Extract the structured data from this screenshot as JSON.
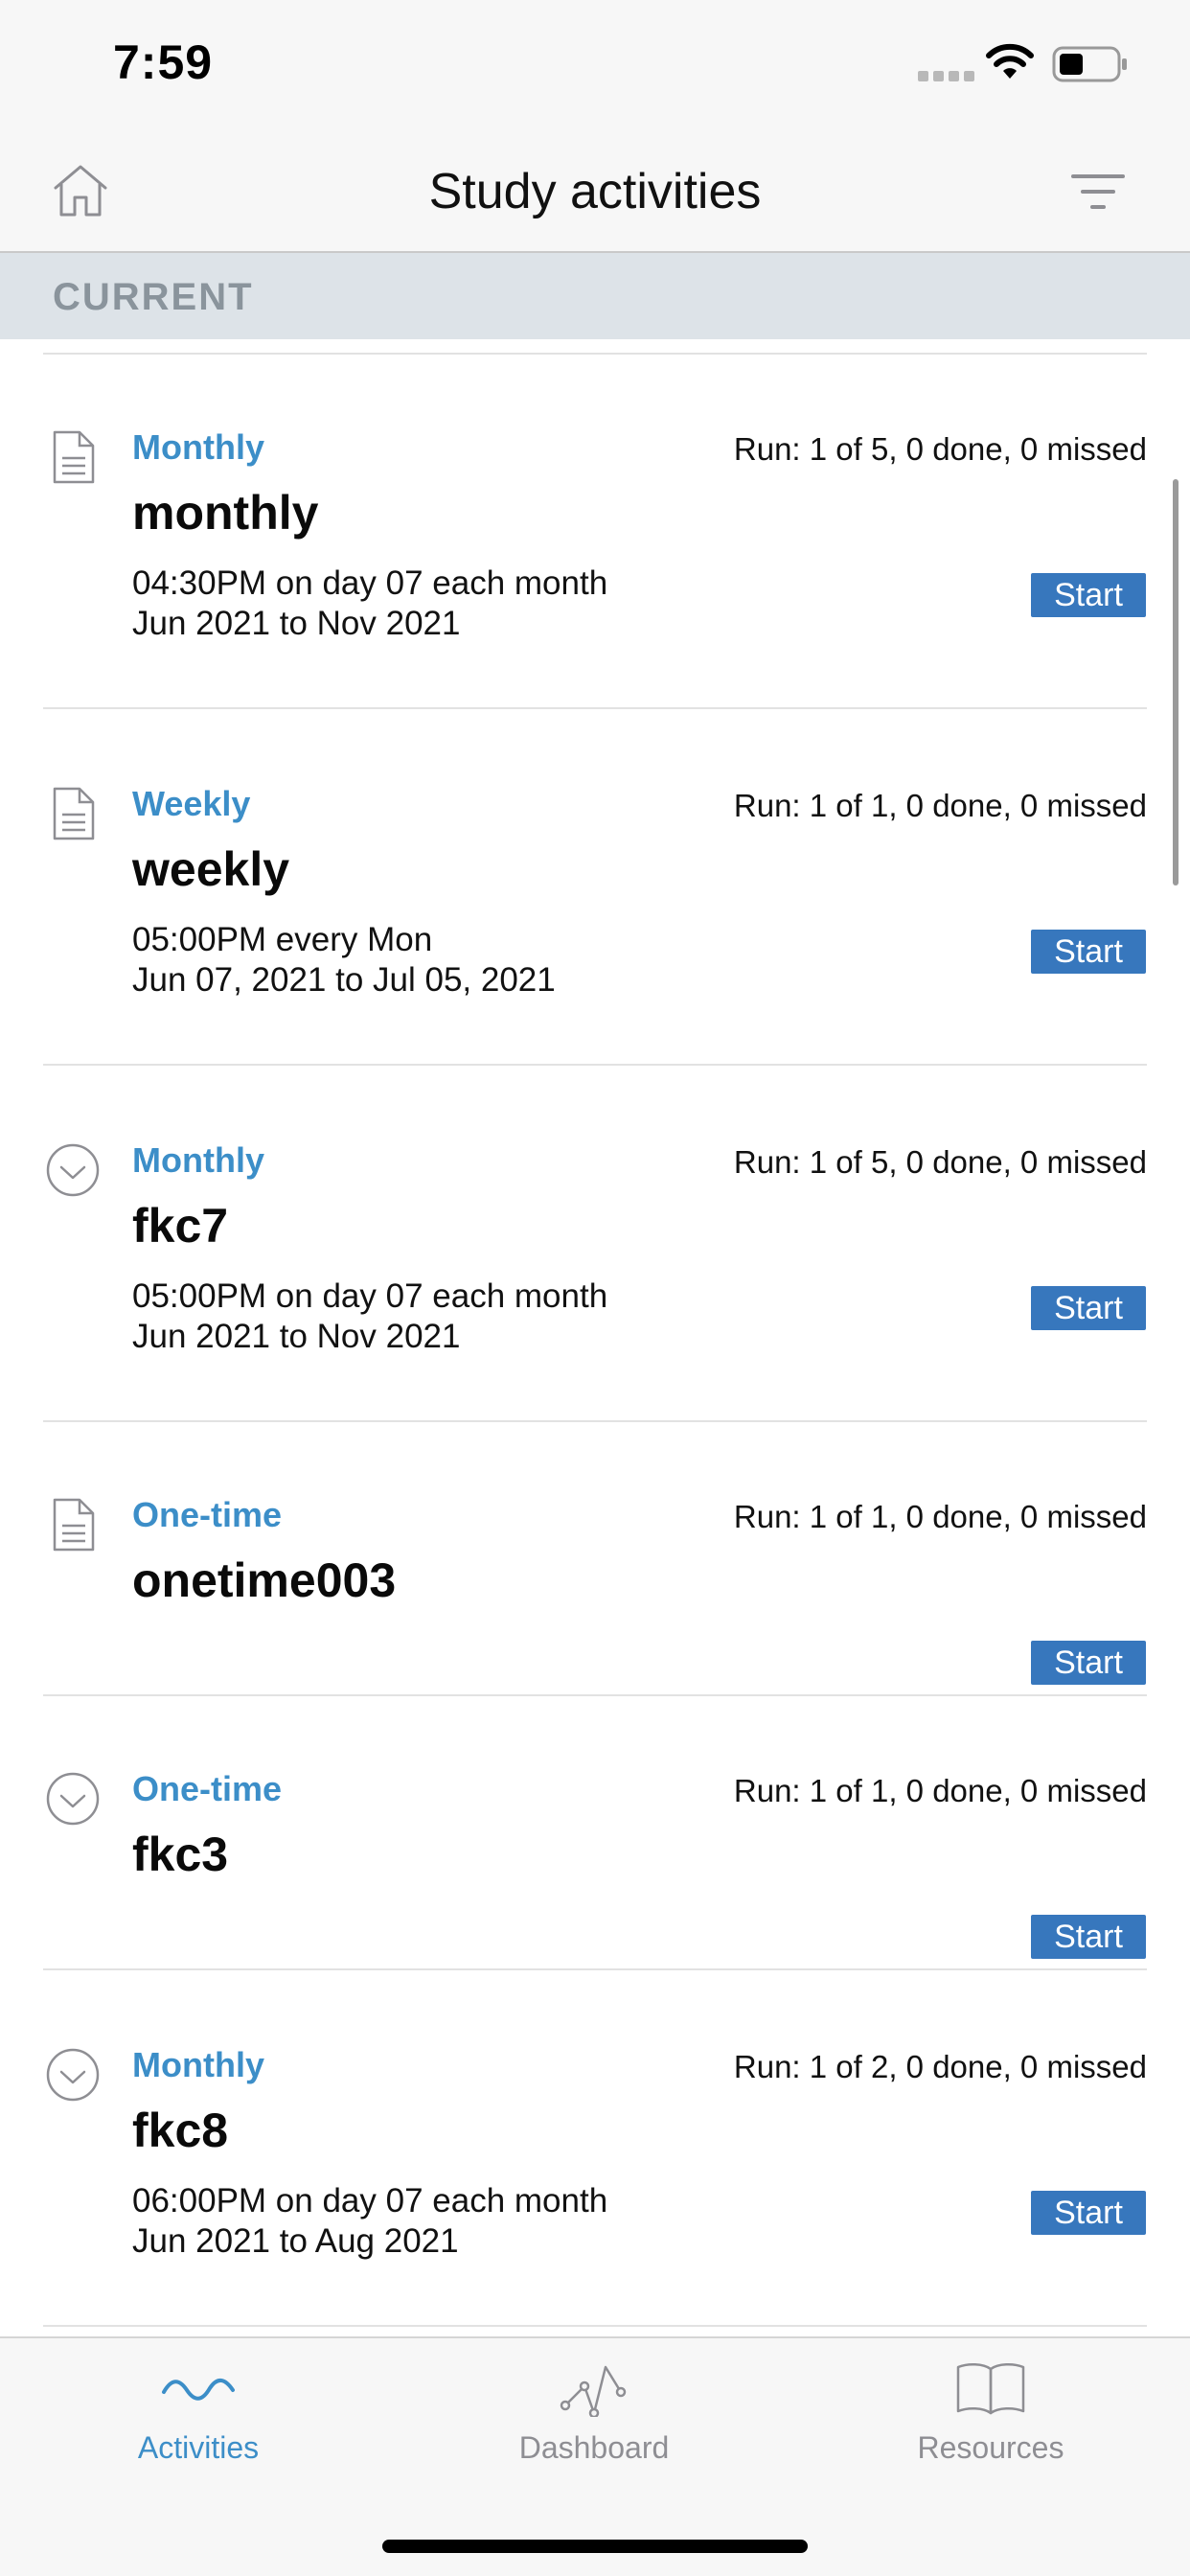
{
  "status_bar": {
    "time": "7:59"
  },
  "nav": {
    "title": "Study activities"
  },
  "section": {
    "label": "CURRENT"
  },
  "activities": [
    {
      "frequency": "Monthly",
      "run": "Run: 1 of 5, 0 done, 0 missed",
      "name": "monthly",
      "schedule_line1": "04:30PM on day 07 each month",
      "schedule_line2": "Jun 2021 to Nov 2021",
      "start_label": "Start",
      "icon": "document-icon"
    },
    {
      "frequency": "Weekly",
      "run": "Run: 1 of 1, 0 done, 0 missed",
      "name": "weekly",
      "schedule_line1": "05:00PM every Mon",
      "schedule_line2": "Jun 07, 2021 to Jul 05, 2021",
      "start_label": "Start",
      "icon": "document-icon"
    },
    {
      "frequency": "Monthly",
      "run": "Run: 1 of 5, 0 done, 0 missed",
      "name": "fkc7",
      "schedule_line1": "05:00PM on day 07 each month",
      "schedule_line2": "Jun 2021 to Nov 2021",
      "start_label": "Start",
      "icon": "check-circle-icon"
    },
    {
      "frequency": "One-time",
      "run": "Run: 1 of 1, 0 done, 0 missed",
      "name": "onetime003",
      "schedule_line1": "",
      "schedule_line2": "",
      "start_label": "Start",
      "icon": "document-icon"
    },
    {
      "frequency": "One-time",
      "run": "Run: 1 of 1, 0 done, 0 missed",
      "name": "fkc3",
      "schedule_line1": "",
      "schedule_line2": "",
      "start_label": "Start",
      "icon": "check-circle-icon"
    },
    {
      "frequency": "Monthly",
      "run": "Run: 1 of 2, 0 done, 0 missed",
      "name": "fkc8",
      "schedule_line1": "06:00PM on day 07 each month",
      "schedule_line2": "Jun 2021 to Aug 2021",
      "start_label": "Start",
      "icon": "check-circle-icon"
    }
  ],
  "tabs": [
    {
      "label": "Activities",
      "icon": "activities-wave-icon",
      "active": true
    },
    {
      "label": "Dashboard",
      "icon": "dashboard-graph-icon",
      "active": false
    },
    {
      "label": "Resources",
      "icon": "book-icon",
      "active": false
    }
  ],
  "colors": {
    "accent": "#3c8ec8",
    "button": "#3777bd",
    "section_bg": "#dde3e8"
  }
}
